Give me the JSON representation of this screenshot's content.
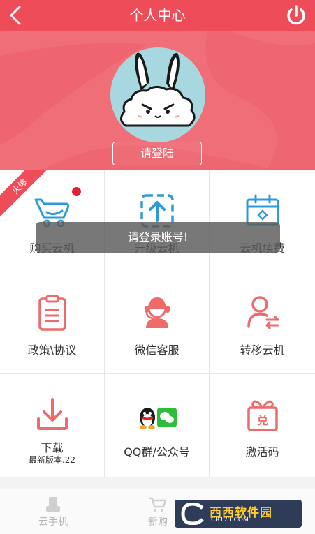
{
  "header": {
    "title": "个人中心",
    "background": "#ee4c58"
  },
  "hero": {
    "login_button": "请登陆",
    "background": "#f06e78"
  },
  "badge": {
    "hot_label": "火爆"
  },
  "grid": {
    "items": [
      {
        "label": "购买云机",
        "icon": "shopping-cart-icon"
      },
      {
        "label": "升级云机",
        "icon": "upgrade-arrow-icon"
      },
      {
        "label": "云机续费",
        "icon": "calendar-renew-icon"
      },
      {
        "label": "政策\\协议",
        "icon": "clipboard-document-icon"
      },
      {
        "label": "微信客服",
        "icon": "customer-service-headset-icon"
      },
      {
        "label": "转移云机",
        "icon": "user-transfer-icon"
      },
      {
        "label": "下载",
        "sublabel": "最新版本.22",
        "icon": "download-icon"
      },
      {
        "label": "QQ群/公众号",
        "icon": "qq-wechat-icon"
      },
      {
        "label": "激活码",
        "icon": "gift-redeem-icon"
      }
    ]
  },
  "toast": {
    "message": "请登录账号!"
  },
  "tabbar": {
    "items": [
      {
        "label": "云手机",
        "icon": "phone-device-icon"
      },
      {
        "label": "新购",
        "icon": "cart-icon"
      }
    ]
  },
  "watermark": {
    "text": "西西软件园",
    "sub": "CR173.COM"
  },
  "colors": {
    "accent": "#ee4c58",
    "icon_red": "#ef6a6a",
    "icon_blue": "#2f9ad8"
  }
}
